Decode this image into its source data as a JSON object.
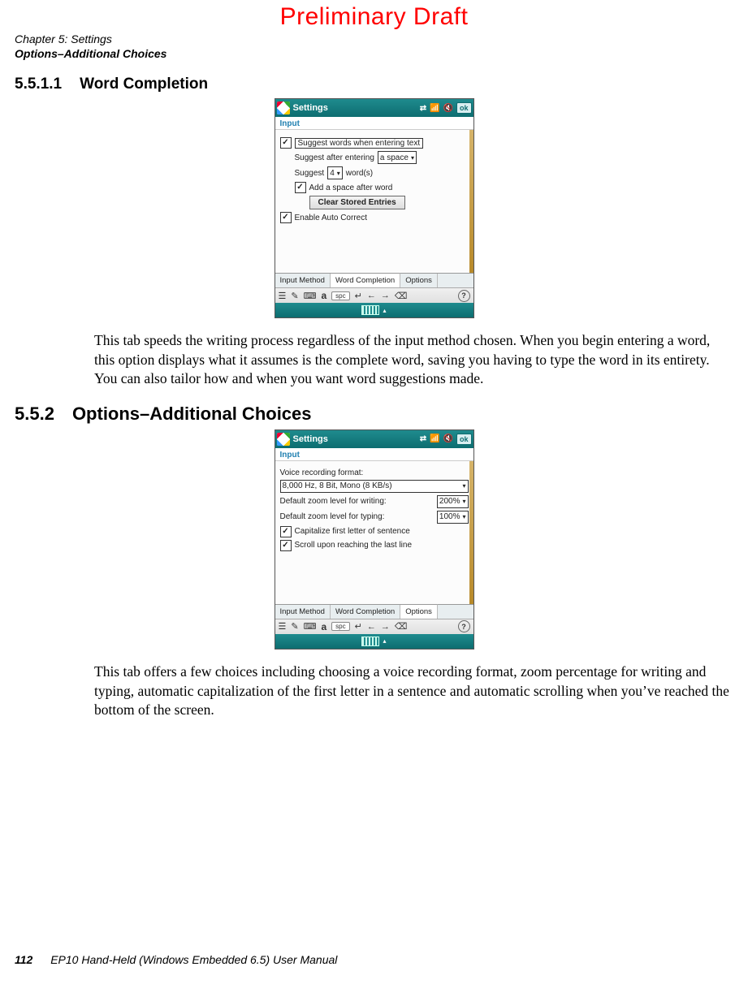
{
  "watermark": "Preliminary Draft",
  "header": {
    "chapter": "Chapter 5:  Settings",
    "section": "Options–Additional Choices"
  },
  "h1": {
    "num": "5.5.1.1",
    "title": "Word Completion"
  },
  "h2": {
    "num": "5.5.2",
    "title": "Options–Additional Choices"
  },
  "para1": "This tab speeds the writing process regardless of the input method chosen. When you begin entering a word, this option displays what it assumes is the complete word, saving you having to type the word in its entirety. You can also tailor how and when you want word sug­gestions made.",
  "para2": "This tab offers a few choices including choosing a voice recording format, zoom percentage for writing and typing, automatic capitalization of the first letter in a sentence and automatic scrolling when you’ve reached the bottom of the screen.",
  "wm": {
    "title": "Settings",
    "ok": "ok",
    "subtitle": "Input",
    "tabs": {
      "t1": "Input Method",
      "t2": "Word Completion",
      "t3": "Options"
    },
    "sip": {
      "spc": "spc"
    }
  },
  "shot1": {
    "r1": "Suggest words when entering text",
    "r2a": "Suggest after entering",
    "r2b": "a space",
    "r3a": "Suggest",
    "r3b": "4",
    "r3c": "word(s)",
    "r4": "Add a space after word",
    "btn": "Clear Stored Entries",
    "r5": "Enable Auto Correct"
  },
  "shot2": {
    "r1": "Voice recording format:",
    "dd1": "8,000 Hz, 8 Bit, Mono (8 KB/s)",
    "r2": "Default zoom level for writing:",
    "dd2": "200%",
    "r3": "Default zoom level for typing:",
    "dd3": "100%",
    "r4": "Capitalize first letter of sentence",
    "r5": "Scroll upon reaching the last line"
  },
  "footer": {
    "page": "112",
    "book": "EP10 Hand-Held (Windows Embedded 6.5) User Manual"
  }
}
